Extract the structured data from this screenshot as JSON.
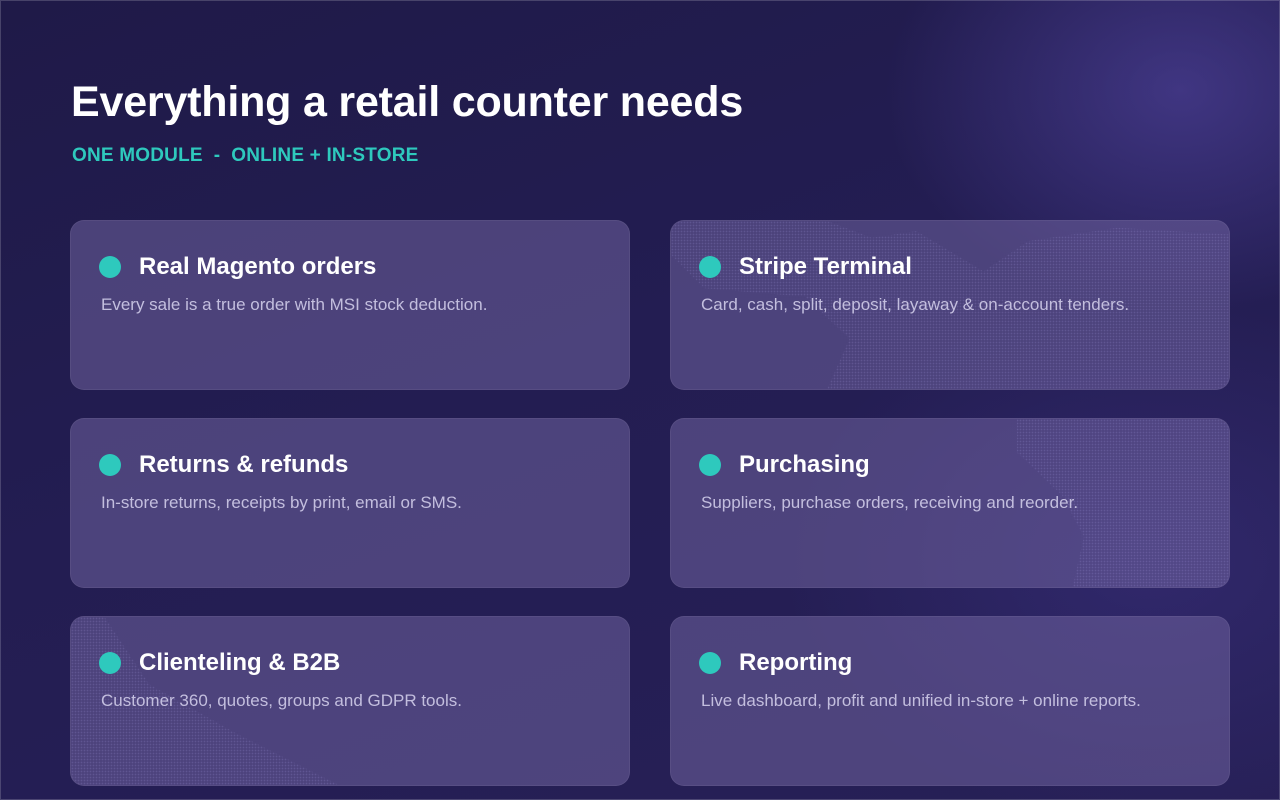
{
  "header": {
    "title": "Everything a retail counter needs",
    "subtitle": "ONE MODULE  -  ONLINE + IN-STORE"
  },
  "colors": {
    "accent": "#2ec9bd",
    "background": "#231d52",
    "card": "#5a4f86"
  },
  "features": [
    {
      "title": "Real Magento orders",
      "description": "Every sale is a true order with MSI stock deduction."
    },
    {
      "title": "Stripe Terminal",
      "description": "Card, cash, split, deposit, layaway & on-account tenders."
    },
    {
      "title": "Returns & refunds",
      "description": "In-store returns, receipts by print, email or SMS."
    },
    {
      "title": "Purchasing",
      "description": "Suppliers, purchase orders, receiving and reorder."
    },
    {
      "title": "Clienteling & B2B",
      "description": "Customer 360, quotes, groups and GDPR tools."
    },
    {
      "title": "Reporting",
      "description": "Live dashboard, profit and unified in-store + online reports."
    }
  ]
}
